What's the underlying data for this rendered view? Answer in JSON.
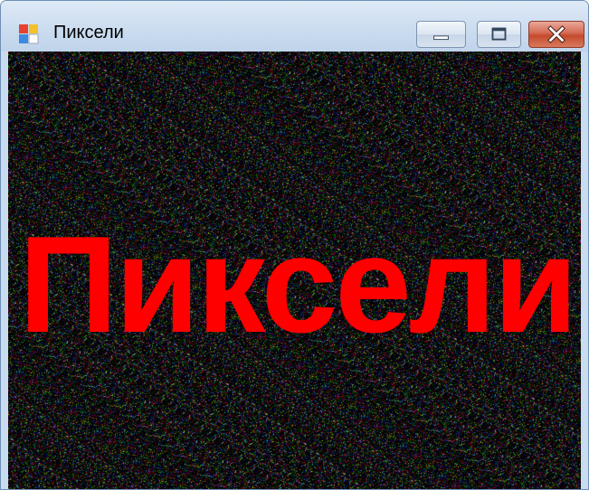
{
  "window": {
    "title": "Пиксели",
    "icon": "winforms-app-icon",
    "controls": {
      "minimize": "minimize-icon",
      "maximize": "maximize-icon",
      "close": "close-icon"
    }
  },
  "canvas": {
    "caption": "Пиксели",
    "caption_color": "#ff0000",
    "background": "random-color-pixel-noise"
  }
}
